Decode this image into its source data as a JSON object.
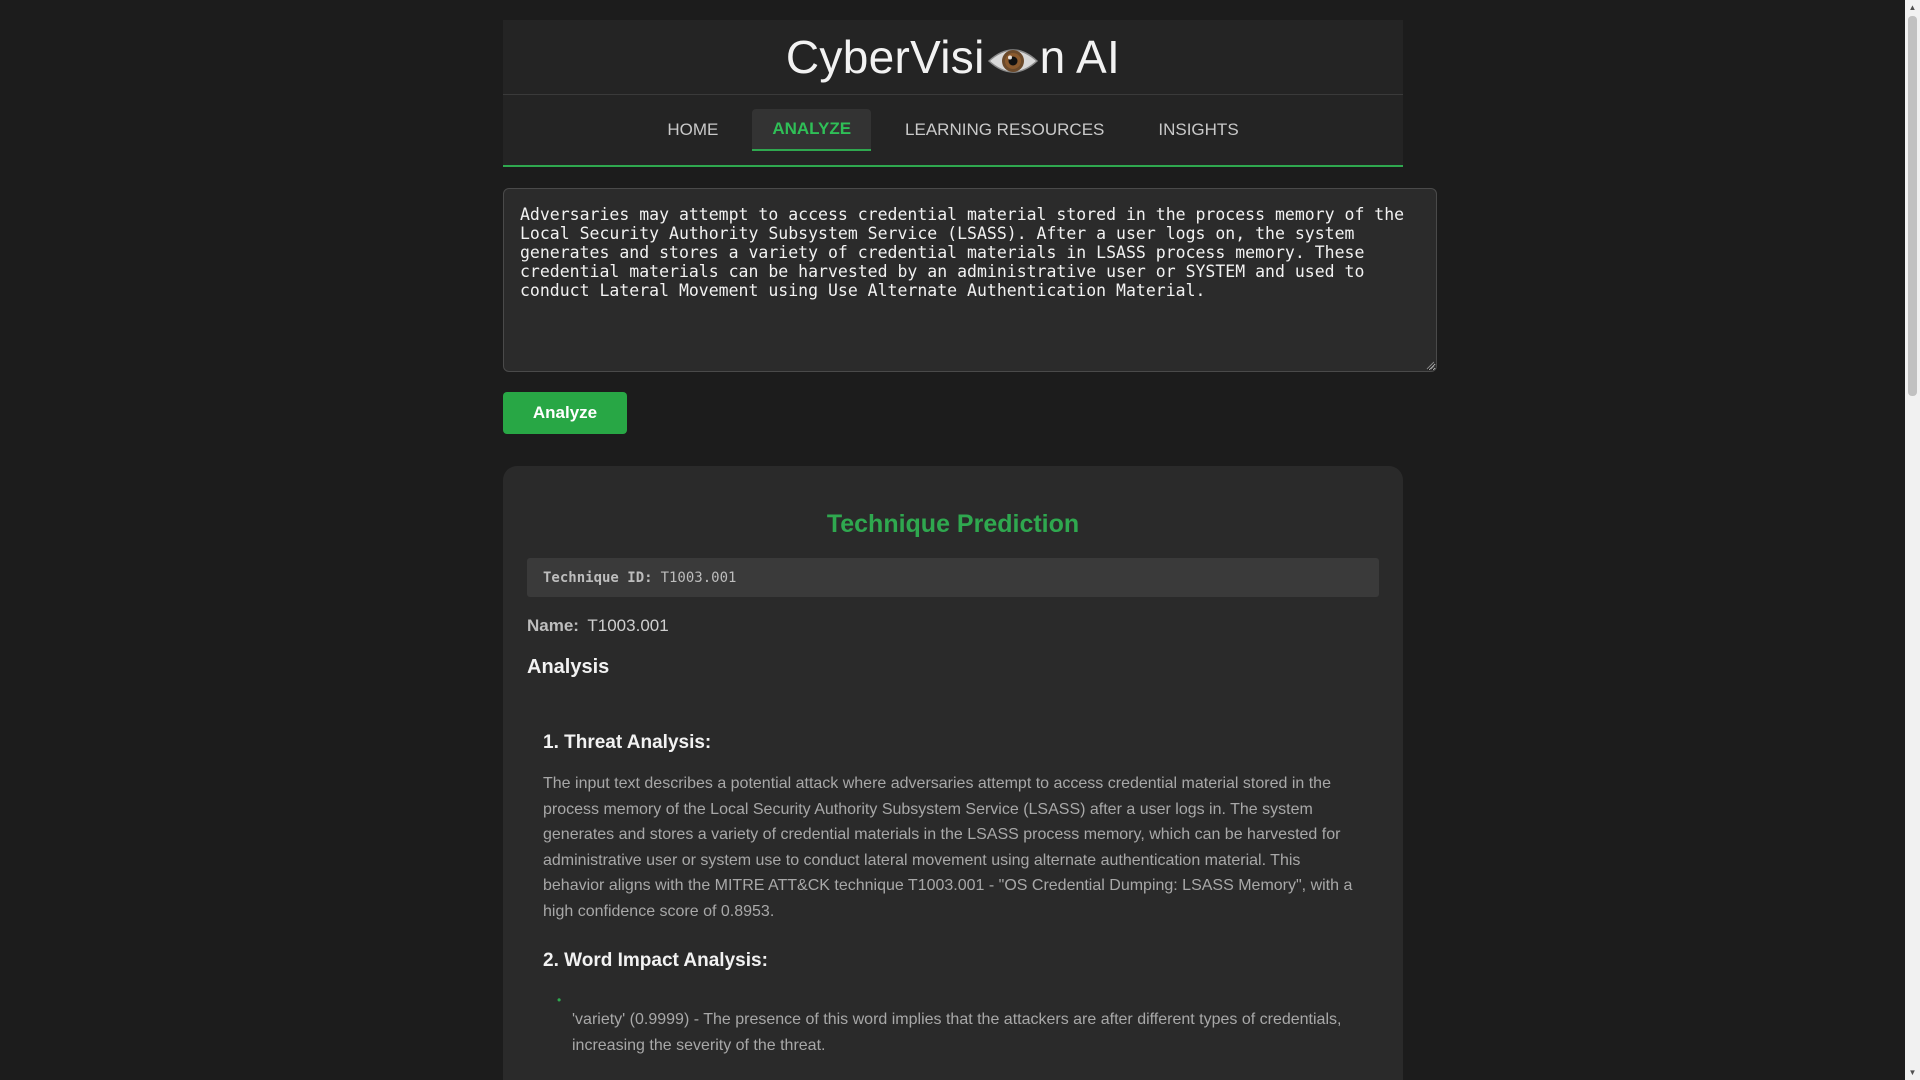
{
  "header": {
    "title_prefix": "CyberVisi",
    "title_suffix": "n AI",
    "logo_icon": "eye-icon"
  },
  "nav": {
    "items": [
      {
        "label": "HOME"
      },
      {
        "label": "ANALYZE",
        "active": true
      },
      {
        "label": "LEARNING RESOURCES"
      },
      {
        "label": "INSIGHTS"
      }
    ]
  },
  "input": {
    "value": "Adversaries may attempt to access credential material stored in the process memory of the Local Security Authority Subsystem Service (LSASS). After a user logs on, the system generates and stores a variety of credential materials in LSASS process memory. These credential materials can be harvested by an administrative user or SYSTEM and used to conduct Lateral Movement using Use Alternate Authentication Material."
  },
  "analyze_button": {
    "label": "Analyze"
  },
  "result": {
    "title": "Technique Prediction",
    "technique_id_label": "Technique ID:",
    "technique_id": "T1003.001",
    "name_label": "Name:",
    "name": "T1003.001",
    "analysis_heading": "Analysis",
    "section1_heading": "1. Threat Analysis:",
    "section1_text": "The input text describes a potential attack where adversaries attempt to access credential material stored in the process memory of the Local Security Authority Subsystem Service (LSASS) after a user logs in. The system generates and stores a variety of credential materials in the LSASS process memory, which can be harvested for administrative user or system use to conduct lateral movement using alternate authentication material. This behavior aligns with the MITRE ATT&CK technique T1003.001 - \"OS Credential Dumping: LSASS Memory\", with a high confidence score of 0.8953.",
    "section2_heading": "2. Word Impact Analysis:",
    "section2_items": [
      "'variety' (0.9999) - The presence of this word implies that the attackers are after different types of credentials, increasing the severity of the threat."
    ]
  },
  "colors": {
    "background": "#1c1c1c",
    "panel": "#242424",
    "accent": "#2fa84f",
    "button": "#28a745"
  }
}
